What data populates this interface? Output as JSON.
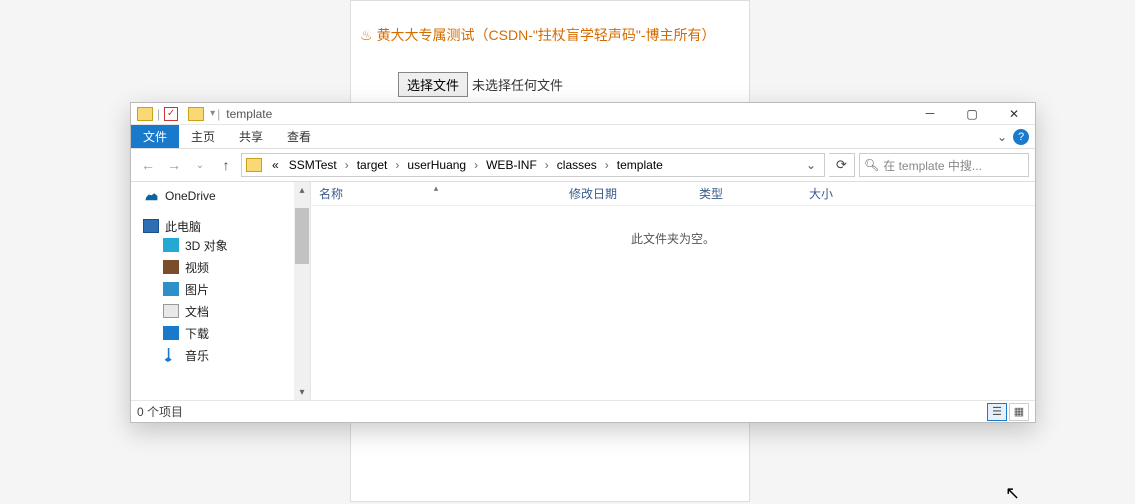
{
  "bg": {
    "header": "黄大大专属测试（CSDN-\"拄杖盲学轻声码\"-博主所有）",
    "choose_btn": "选择文件",
    "no_file": "未选择任何文件"
  },
  "titlebar": {
    "title": "template"
  },
  "ribbon": {
    "file": "文件",
    "home": "主页",
    "share": "共享",
    "view": "查看"
  },
  "nav_buttons": {
    "back": "←",
    "forward": "→",
    "up": "↑"
  },
  "breadcrumbs": {
    "prefix": "«",
    "items": [
      "SSMTest",
      "target",
      "userHuang",
      "WEB-INF",
      "classes",
      "template"
    ]
  },
  "search": {
    "placeholder": "在 template 中搜..."
  },
  "navpane": {
    "onedrive": "OneDrive",
    "thispc": "此电脑",
    "items": [
      {
        "icon": "ico-3d",
        "label": "3D 对象"
      },
      {
        "icon": "ico-video",
        "label": "视频"
      },
      {
        "icon": "ico-pic",
        "label": "图片"
      },
      {
        "icon": "ico-doc",
        "label": "文档"
      },
      {
        "icon": "ico-down",
        "label": "下载"
      },
      {
        "icon": "ico-music",
        "label": "音乐"
      }
    ]
  },
  "columns": {
    "name": "名称",
    "date": "修改日期",
    "type": "类型",
    "size": "大小"
  },
  "empty_text": "此文件夹为空。",
  "status": {
    "count": "0 个项目"
  }
}
